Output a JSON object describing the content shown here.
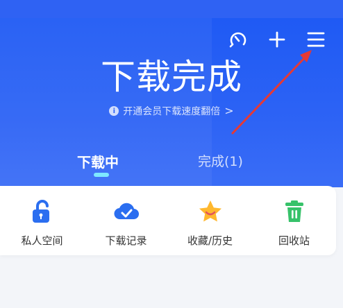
{
  "header": {
    "title": "下载完成",
    "promo_text": "开通会员下载速度翻倍",
    "promo_chevron": ">",
    "info_glyph": "i",
    "icons": [
      "speedometer-icon",
      "plus-icon",
      "menu-icon"
    ]
  },
  "tabs": [
    {
      "label": "下载中"
    },
    {
      "label": "完成(1)"
    }
  ],
  "tools": [
    {
      "label": "私人空间",
      "icon": "unlock-icon"
    },
    {
      "label": "下载记录",
      "icon": "cloud-check-icon"
    },
    {
      "label": "收藏/历史",
      "icon": "star-icon"
    },
    {
      "label": "回收站",
      "icon": "trash-icon"
    }
  ],
  "colors": {
    "header_blue": "#2d63f5",
    "tab_indicator": "#7ee8ff",
    "annotation_arrow": "#e53935"
  }
}
